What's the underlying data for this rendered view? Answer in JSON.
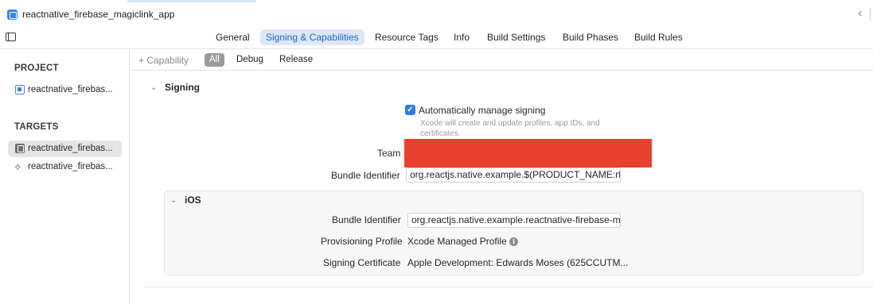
{
  "window": {
    "title": "reactnative_firebase_magiclink_app"
  },
  "tabs": [
    {
      "label": "General",
      "selected": false
    },
    {
      "label": "Signing & Capabilities",
      "selected": true
    },
    {
      "label": "Resource Tags",
      "selected": false
    },
    {
      "label": "Info",
      "selected": false
    },
    {
      "label": "Build Settings",
      "selected": false
    },
    {
      "label": "Build Phases",
      "selected": false
    },
    {
      "label": "Build Rules",
      "selected": false
    }
  ],
  "sidebar": {
    "project_header": "PROJECT",
    "project_item": "reactnative_firebas...",
    "targets_header": "TARGETS",
    "targets": [
      {
        "label": "reactnative_firebas...",
        "selected": true,
        "icon": "app-target-icon"
      },
      {
        "label": "reactnative_firebas...",
        "selected": false,
        "icon": "extension-icon"
      }
    ]
  },
  "filter_bar": {
    "capability": "+ Capability",
    "filters": [
      "All",
      "Debug",
      "Release"
    ],
    "selected_filter": "All"
  },
  "signing": {
    "header": "Signing",
    "auto_manage_label": "Automatically manage signing",
    "auto_manage_checked": true,
    "auto_manage_help": "Xcode will create and update profiles, app IDs, and certificates.",
    "team_label": "Team",
    "bundle_id_label": "Bundle Identifier",
    "bundle_id_value": "org.reactjs.native.example.$(PRODUCT_NAME:rfc"
  },
  "ios": {
    "header": "iOS",
    "bundle_id_label": "Bundle Identifier",
    "bundle_id_value": "org.reactjs.native.example.reactnative-firebase-m",
    "prov_profile_label": "Provisioning Profile",
    "prov_profile_value": "Xcode Managed Profile",
    "signing_cert_label": "Signing Certificate",
    "signing_cert_value": "Apple Development: Edwards Moses (625CCUTM..."
  },
  "colors": {
    "accent": "#2c7cf6",
    "selected_tab_bg": "#dde7f7",
    "redaction": "#e9412d"
  }
}
